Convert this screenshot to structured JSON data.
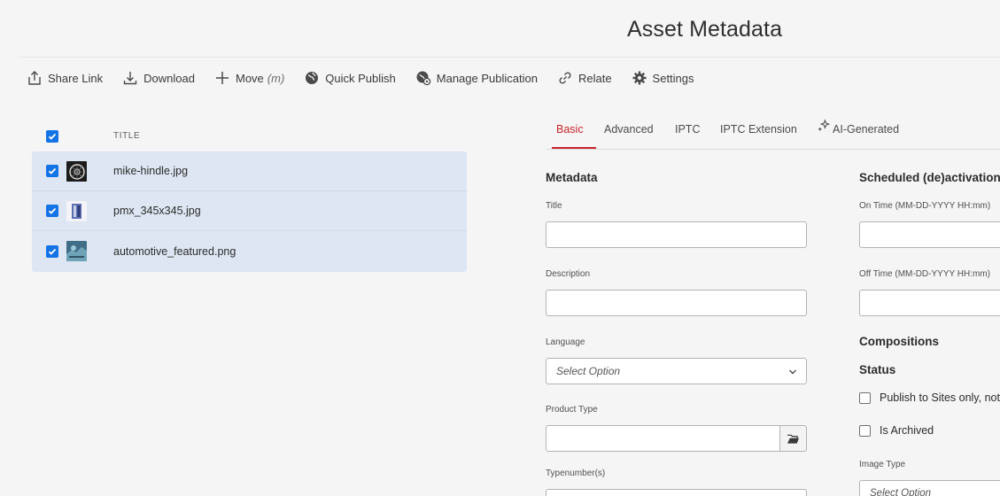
{
  "page": {
    "title": "Asset Metadata"
  },
  "toolbar": {
    "share_link": "Share Link",
    "download": "Download",
    "move": "Move",
    "move_shortcut": "(m)",
    "quick_publish": "Quick Publish",
    "manage_publication": "Manage Publication",
    "relate": "Relate",
    "settings": "Settings"
  },
  "asset_list": {
    "column_title": "TITLE",
    "select_all_checked": true,
    "rows": [
      {
        "name": "mike-hindle.jpg",
        "checked": true,
        "thumbnail": "bike-wheel-thumbnail"
      },
      {
        "name": "pmx_345x345.jpg",
        "checked": true,
        "thumbnail": "product-box-thumbnail"
      },
      {
        "name": "automotive_featured.png",
        "checked": true,
        "thumbnail": "automotive-thumbnail"
      }
    ]
  },
  "tabs": [
    {
      "label": "Basic",
      "active": true
    },
    {
      "label": "Advanced",
      "active": false
    },
    {
      "label": "IPTC",
      "active": false
    },
    {
      "label": "IPTC Extension",
      "active": false
    },
    {
      "label": "AI-Generated",
      "active": false,
      "icon": "sparkle-icon"
    }
  ],
  "metadata": {
    "section_title": "Metadata",
    "title_label": "Title",
    "title_value": "",
    "description_label": "Description",
    "description_value": "",
    "language_label": "Language",
    "language_placeholder": "Select Option",
    "product_type_label": "Product Type",
    "product_type_value": "",
    "typenumbers_label": "Typenumber(s)"
  },
  "scheduling": {
    "section_title": "Scheduled (de)activation",
    "on_time_label": "On Time (MM-DD-YYYY HH:mm)",
    "off_time_label": "Off Time (MM-DD-YYYY HH:mm)",
    "compositions_title": "Compositions",
    "status_title": "Status",
    "publish_sites_label": "Publish to Sites only, not t",
    "is_archived_label": "Is Archived",
    "image_type_label": "Image Type",
    "image_type_placeholder": "Select Option"
  },
  "colors": {
    "accent_blue": "#1473e6",
    "tab_active_red": "#c9252d",
    "selected_row_bg": "#dde6f2"
  }
}
